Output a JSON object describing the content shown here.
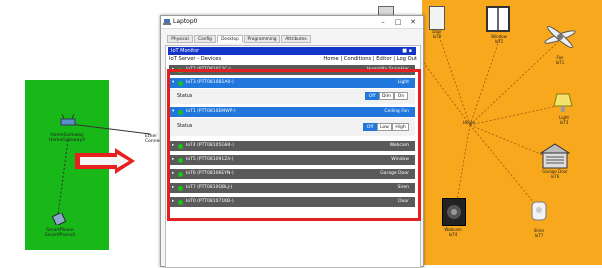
{
  "left_canvas": {
    "gateway_label": "HomeGateway\nHomeGateway0",
    "cable_label": "Ether\nConnect",
    "device_label": "SmartPhone\nSmartPhone0"
  },
  "window": {
    "title": "Laptop0",
    "tabs": [
      "Physical",
      "Config",
      "Desktop",
      "Programming",
      "Attributes"
    ],
    "active_tab": "Desktop"
  },
  "browser": {
    "url": "IoT Monitor",
    "url_menu": "■ ▪",
    "page_title": "IoT Server - Devices",
    "nav_links": "Home | Conditions | Editor | Log Out"
  },
  "devices": [
    {
      "name": "IoT2 (PTT081012C-)",
      "type": "Humidity Sprinkler",
      "open": false
    },
    {
      "name": "IoT3 (PTT0810B1A0-)",
      "type": "Light",
      "open": true,
      "control_label": "Status",
      "options": [
        "Off",
        "Dim",
        "On"
      ],
      "selected": "Off"
    },
    {
      "name": "IoT1 (PTT0810EMWP-)",
      "type": "Ceiling Fan",
      "open": true,
      "control_label": "Status",
      "options": [
        "Off",
        "Low",
        "High"
      ],
      "selected": "Off"
    },
    {
      "name": "IoT4 (PTT08105G84-)",
      "type": "Webcam",
      "open": false
    },
    {
      "name": "IoT5 (PTT081091Z4-)",
      "type": "Window",
      "open": false
    },
    {
      "name": "IoT6 (PTT08106EYN-)",
      "type": "Garage Door",
      "open": false
    },
    {
      "name": "IoT7 (PTT0810QBLJ-)",
      "type": "Siren",
      "open": false
    },
    {
      "name": "IoT0 (PTT081071KB-)",
      "type": "Door",
      "open": false
    }
  ],
  "environment": {
    "center_label": "Home",
    "devices": [
      {
        "label": "Door\nIoT0"
      },
      {
        "label": "Window\nIoT5"
      },
      {
        "label": "Fan\nIoT1"
      },
      {
        "label": "Light\nIoT3"
      },
      {
        "label": "Garage Door\nIoT6"
      },
      {
        "label": "Webcam\nIoT4"
      },
      {
        "label": "Siren\nIoT7"
      }
    ]
  },
  "colors": {
    "accent_blue": "#2277dd",
    "url_bar": "#1436c8",
    "highlight_red": "#e22020",
    "zone_green": "#18b818",
    "env_orange": "#f8a81c",
    "status_green": "#19c419"
  }
}
